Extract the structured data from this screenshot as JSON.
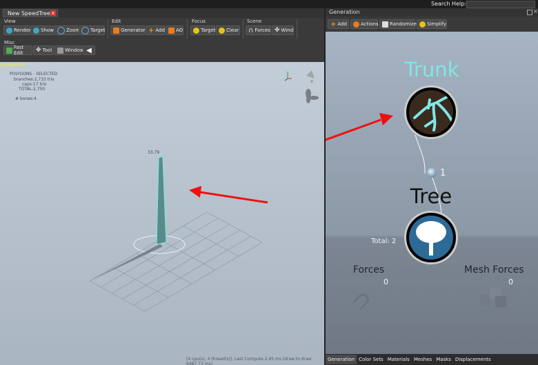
{
  "top": {
    "search_label": "Search Help:"
  },
  "document_tab": {
    "title": "New SpeedTree▾",
    "close": "x"
  },
  "toolbar": {
    "groups": {
      "view": "View",
      "edit": "Edit",
      "focus": "Focus",
      "scene": "Scene",
      "misc": "Misc"
    },
    "view": {
      "render": "Render",
      "show": "Show",
      "zoom": "Zoom",
      "target": "Target"
    },
    "edit": {
      "generators": "Generators",
      "add": "Add",
      "ao": "AO"
    },
    "focus": {
      "target": "Target",
      "clear": "Clear"
    },
    "scene": {
      "forces": "Forces",
      "wind": "Wind"
    },
    "misc": {
      "fast_edit": "Fast Edit",
      "tool": "Tool",
      "window": "Window"
    }
  },
  "viewport": {
    "mode": "perspective",
    "stats": {
      "header": "POLYGONS - SELECTED",
      "branches": "branches:2,733 tris",
      "caps": "caps:17 tris",
      "total": "TOTAL:2,750",
      "bones": "# bones:4"
    },
    "height_label": "33.79",
    "status": "[4 cpu(s), 4 thread(s)], Last Compute 2.45 ms (draw to draw 6487.73 ms)"
  },
  "generation": {
    "title": "Generation",
    "toolbar": {
      "add": "Add",
      "actions": "Actions",
      "randomize": "Randomize",
      "simplify": "Simplify"
    },
    "nodes": {
      "trunk": "Trunk",
      "connector_count": "1",
      "tree": "Tree",
      "total": "Total: 2",
      "forces": "Forces",
      "forces_count": "0",
      "mesh_forces": "Mesh Forces",
      "mesh_forces_count": "0"
    },
    "tabs": [
      "Generation",
      "Color Sets",
      "Materials",
      "Meshes",
      "Masks",
      "Displacements"
    ]
  },
  "colors": {
    "accent_cyan": "#7fe7e6",
    "trunk_bark": "#3a2a1e",
    "tree_blue": "#2d6a96",
    "annotation_red": "#ee1111"
  }
}
